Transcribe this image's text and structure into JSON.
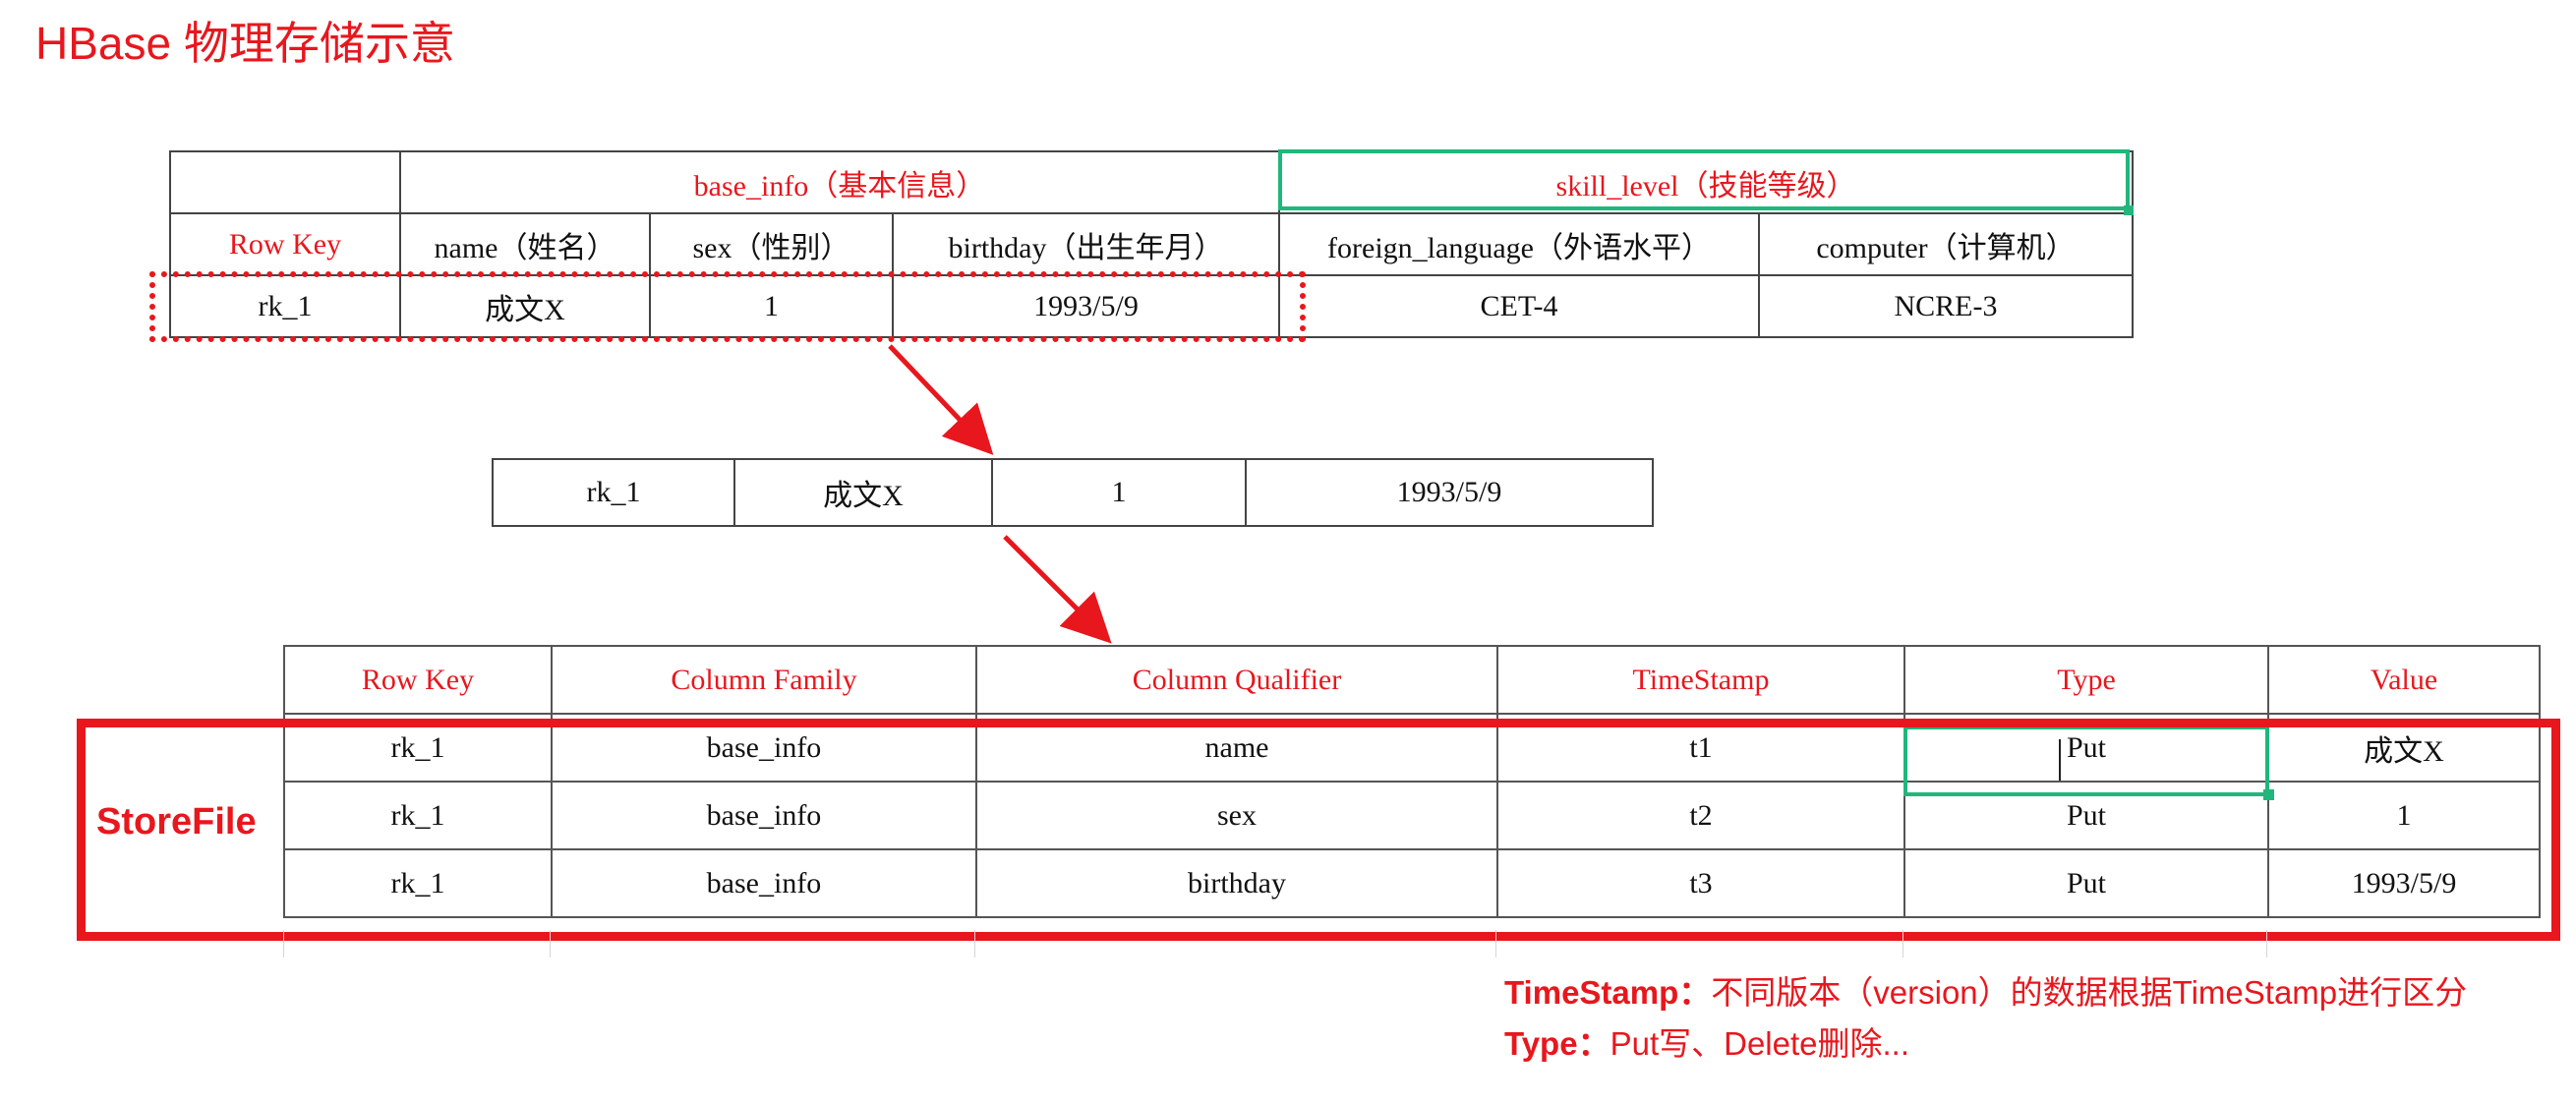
{
  "title": "HBase 物理存储示意",
  "top_table": {
    "family1": "base_info（基本信息）",
    "family2": "skill_level（技能等级）",
    "headers": [
      "Row Key",
      "name（姓名）",
      "sex（性别）",
      "birthday（出生年月）",
      "foreign_language（外语水平）",
      "computer（计算机）"
    ],
    "row": [
      "rk_1",
      "成文X",
      "1",
      "1993/5/9",
      "CET-4",
      "NCRE-3"
    ]
  },
  "middle_row": [
    "rk_1",
    "成文X",
    "1",
    "1993/5/9"
  ],
  "storefile": {
    "label": "StoreFile",
    "headers": [
      "Row Key",
      "Column Family",
      "Column Qualifier",
      "TimeStamp",
      "Type",
      "Value"
    ],
    "rows": [
      [
        "rk_1",
        "base_info",
        "name",
        "t1",
        "Put",
        "成文X"
      ],
      [
        "rk_1",
        "base_info",
        "sex",
        "t2",
        "Put",
        "1"
      ],
      [
        "rk_1",
        "base_info",
        "birthday",
        "t3",
        "Put",
        "1993/5/9"
      ]
    ]
  },
  "notes": {
    "timestamp_key": "TimeStamp：",
    "timestamp_text": "不同版本（version）的数据根据TimeStamp进行区分",
    "type_key": "Type：",
    "type_text": "Put写、Delete删除..."
  },
  "colors": {
    "accent_red": "#e8171d",
    "selection_green": "#1fb77b"
  }
}
